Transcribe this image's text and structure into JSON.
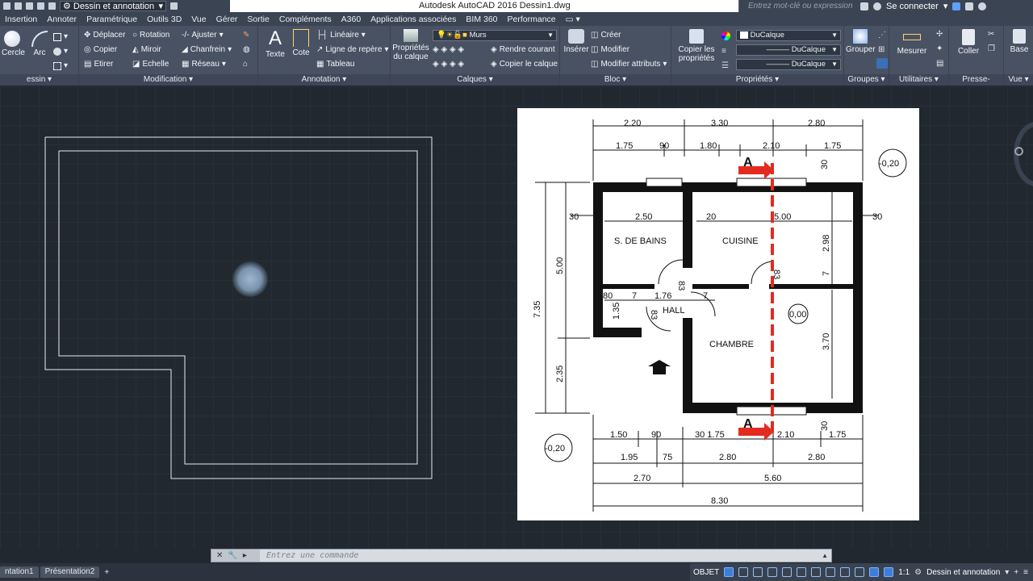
{
  "title_bar": {
    "workspace": "Dessin et annotation",
    "app_title": "Autodesk AutoCAD 2016    Dessin1.dwg",
    "search_placeholder": "Entrez mot-clé ou expression",
    "signin": "Se connecter"
  },
  "menu_tabs": [
    "Insertion",
    "Annoter",
    "Paramétrique",
    "Outils 3D",
    "Vue",
    "Gérer",
    "Sortie",
    "Compléments",
    "A360",
    "Applications associées",
    "BIM 360",
    "Performance"
  ],
  "ribbon": {
    "dessin": {
      "title": "essin",
      "cercle": "Cercle",
      "arc": "Arc"
    },
    "modification": {
      "title": "Modification",
      "deplacer": "Déplacer",
      "rotation": "Rotation",
      "ajuster": "Ajuster",
      "copier": "Copier",
      "miroir": "Miroir",
      "chanfrein": "Chanfrein",
      "etirer": "Etirer",
      "echelle": "Echelle",
      "reseau": "Réseau"
    },
    "annotation": {
      "title": "Annotation",
      "texte": "Texte",
      "cote": "Cote",
      "lineaire": "Linéaire",
      "ligne_repere": "Ligne de repère",
      "tableau": "Tableau"
    },
    "calques": {
      "title": "Calques",
      "proprietes": "Propriétés du calque",
      "layer_value": "Murs",
      "rendre_courant": "Rendre courant",
      "copier_calque": "Copier le calque"
    },
    "bloc": {
      "title": "Bloc",
      "inserer": "Insérer",
      "creer": "Créer",
      "modifier": "Modifier",
      "modifier_attributs": "Modifier attributs"
    },
    "proprietes": {
      "title": "Propriétés",
      "copier_proprietes": "Copier les propriétés",
      "color": "DuCalque",
      "linetype": "DuCalque",
      "lineweight": "DuCalque"
    },
    "groupes": {
      "title": "Groupes",
      "grouper": "Grouper"
    },
    "utilitaires": {
      "title": "Utilitaires",
      "mesurer": "Mesurer"
    },
    "presse_papiers": {
      "title": "Presse-papiers",
      "coller": "Coller"
    },
    "vue": {
      "title": "Vue",
      "base": "Base"
    }
  },
  "plan": {
    "top_dims_row1": [
      "2.20",
      "3.30",
      "2.80"
    ],
    "top_dims_row2": [
      "1.75",
      "90",
      "1.80",
      "2.10",
      "1.75"
    ],
    "bottom_dims_row1": [
      "1.50",
      "90",
      "30 1.75",
      "2.10",
      "1.75"
    ],
    "bottom_dims_row2": [
      "1.95",
      "75",
      "2.80",
      "2.80"
    ],
    "bottom_dims_row3": [
      "2.70",
      "5.60"
    ],
    "bottom_total": "8.30",
    "left_dims": [
      "7.35",
      "5.00",
      "2.35"
    ],
    "rooms": [
      "S. DE BAINS",
      "CUISINE",
      "HALL",
      "CHAMBRE"
    ],
    "inner_dims": [
      "2.50",
      "20",
      "5.00",
      "30",
      "30",
      "80",
      "7",
      "1.76",
      "7",
      "1.35",
      "83",
      "83",
      "83",
      "2.98",
      "7",
      "3.70",
      "30",
      "30"
    ],
    "levels": [
      "-0,20",
      "0,00",
      "-0,20"
    ],
    "section_label": "A"
  },
  "command_line": {
    "placeholder": "Entrez une commande"
  },
  "status_bar": {
    "layout_tabs": [
      "ntation1",
      "Présentation2"
    ],
    "mode": "OBJET",
    "scale": "1:1",
    "workspace": "Dessin et annotation"
  }
}
